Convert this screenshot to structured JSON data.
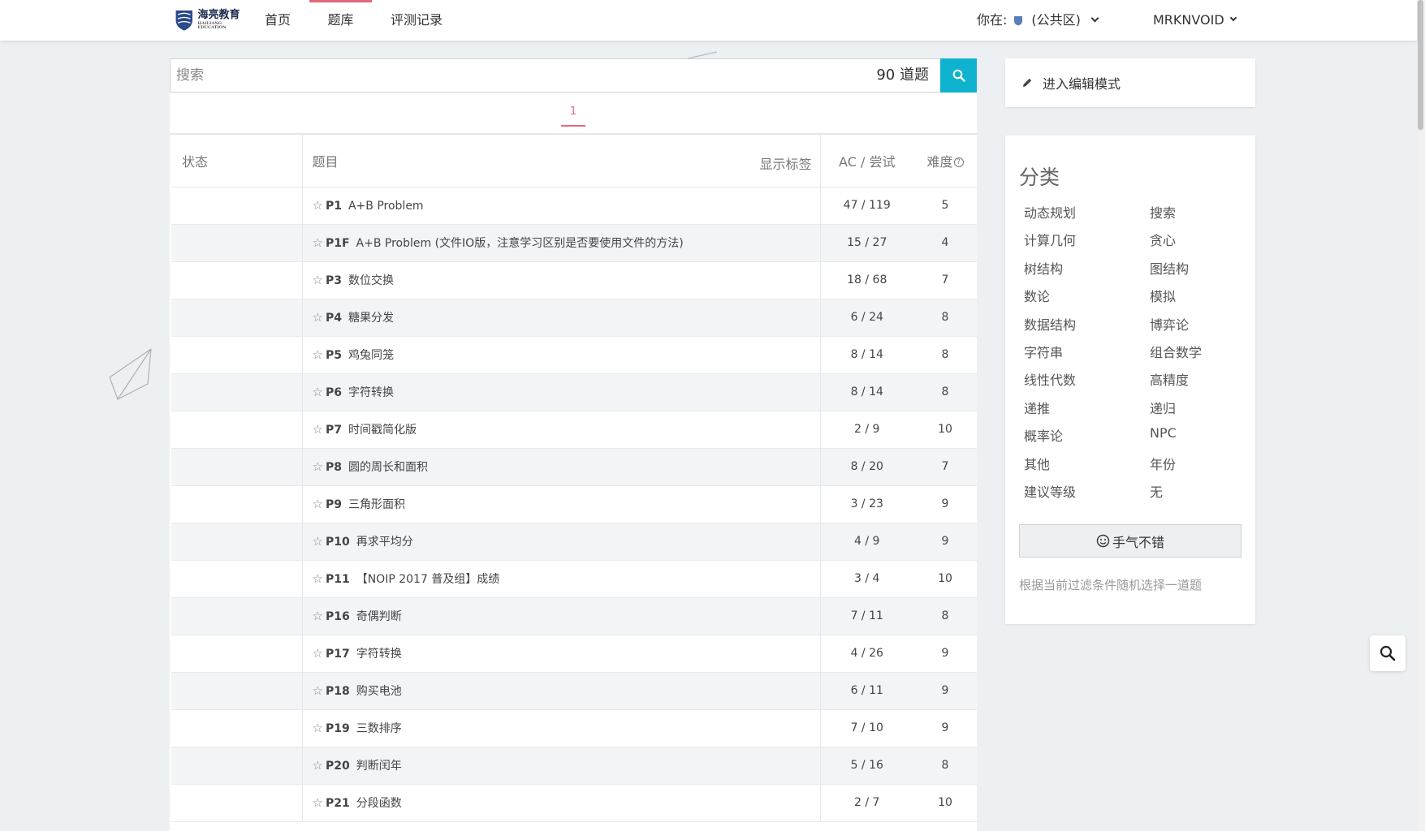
{
  "header": {
    "logo_text": "海亮教育",
    "logo_sub": "HAILIANG EDUCATION",
    "nav": [
      "首页",
      "题库",
      "评测记录"
    ],
    "active_nav": "题库",
    "location_label": "你在:",
    "location_value": "(公共区)",
    "username": "MRKNVOID"
  },
  "search": {
    "placeholder": "搜索",
    "count": "90 道题"
  },
  "pagination": {
    "current": "1"
  },
  "table": {
    "headers": {
      "status": "状态",
      "title": "题目",
      "show_tags": "显示标签",
      "ac": "AC / 尝试",
      "difficulty": "难度"
    },
    "rows": [
      {
        "id": "P1",
        "title": "A+B Problem",
        "ac": "47 / 119",
        "difficulty": "5"
      },
      {
        "id": "P1F",
        "title": "A+B Problem (文件IO版，注意学习区别是否要使用文件的方法)",
        "ac": "15 / 27",
        "difficulty": "4"
      },
      {
        "id": "P3",
        "title": "数位交换",
        "ac": "18 / 68",
        "difficulty": "7"
      },
      {
        "id": "P4",
        "title": "糖果分发",
        "ac": "6 / 24",
        "difficulty": "8"
      },
      {
        "id": "P5",
        "title": "鸡兔同笼",
        "ac": "8 / 14",
        "difficulty": "8"
      },
      {
        "id": "P6",
        "title": "字符转换",
        "ac": "8 / 14",
        "difficulty": "8"
      },
      {
        "id": "P7",
        "title": "时间戳简化版",
        "ac": "2 / 9",
        "difficulty": "10"
      },
      {
        "id": "P8",
        "title": "圆的周长和面积",
        "ac": "8 / 20",
        "difficulty": "7"
      },
      {
        "id": "P9",
        "title": "三角形面积",
        "ac": "3 / 23",
        "difficulty": "9"
      },
      {
        "id": "P10",
        "title": "再求平均分",
        "ac": "4 / 9",
        "difficulty": "9"
      },
      {
        "id": "P11",
        "title": "【NOIP 2017 普及组】成绩",
        "ac": "3 / 4",
        "difficulty": "10"
      },
      {
        "id": "P16",
        "title": "奇偶判断",
        "ac": "7 / 11",
        "difficulty": "8"
      },
      {
        "id": "P17",
        "title": "字符转换",
        "ac": "4 / 26",
        "difficulty": "9"
      },
      {
        "id": "P18",
        "title": "购买电池",
        "ac": "6 / 11",
        "difficulty": "9"
      },
      {
        "id": "P19",
        "title": "三数排序",
        "ac": "7 / 10",
        "difficulty": "9"
      },
      {
        "id": "P20",
        "title": "判断闰年",
        "ac": "5 / 16",
        "difficulty": "8"
      },
      {
        "id": "P21",
        "title": "分段函数",
        "ac": "2 / 7",
        "difficulty": "10"
      }
    ]
  },
  "sidebar": {
    "edit_mode": "进入编辑模式",
    "category_title": "分类",
    "categories": [
      "动态规划",
      "搜索",
      "计算几何",
      "贪心",
      "树结构",
      "图结构",
      "数论",
      "模拟",
      "数据结构",
      "博弈论",
      "字符串",
      "组合数学",
      "线性代数",
      "高精度",
      "递推",
      "递归",
      "概率论",
      "NPC",
      "其他",
      "年份",
      "建议等级",
      "无"
    ],
    "lucky_button": "手气不错",
    "random_note": "根据当前过滤条件随机选择一道题"
  },
  "colors": {
    "accent": "#e0687a",
    "search_button": "#0fb3d0"
  }
}
